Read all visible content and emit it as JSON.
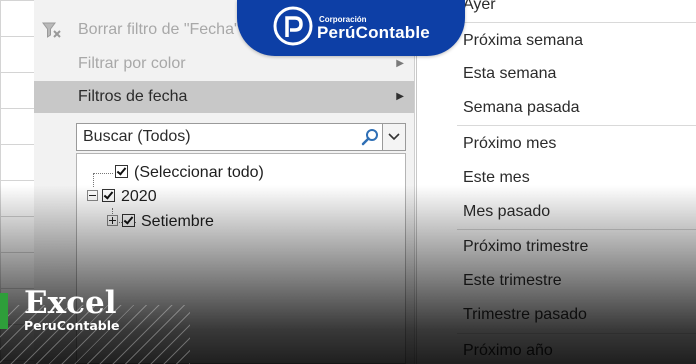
{
  "filter_menu": {
    "clear_filter_label": "Borrar filtro de \"Fecha\"",
    "filter_by_color_label": "Filtrar por color",
    "date_filters_label": "Filtros de fecha",
    "search_placeholder": "Buscar (Todos)",
    "tree": {
      "select_all": "(Seleccionar todo)",
      "year": "2020",
      "month": "Setiembre"
    }
  },
  "date_submenu": {
    "items": [
      "Ayer",
      "Próxima semana",
      "Esta semana",
      "Semana pasada",
      "Próximo mes",
      "Este mes",
      "Mes pasado",
      "Próximo trimestre",
      "Este trimestre",
      "Trimestre pasado",
      "Próximo año"
    ]
  },
  "branding": {
    "corp_small": "Corporación",
    "corp_name": "PerúContable",
    "excel_title": "Excel",
    "excel_subtitle": "PeruContable",
    "brand_color": "#0d3fa6",
    "excel_accent": "#2e9e3a"
  },
  "icons": {
    "clear_filter": "filter-clear-icon",
    "submenu_arrow": "chevron-right-icon",
    "search": "search-icon",
    "dropdown": "chevron-down-icon"
  }
}
